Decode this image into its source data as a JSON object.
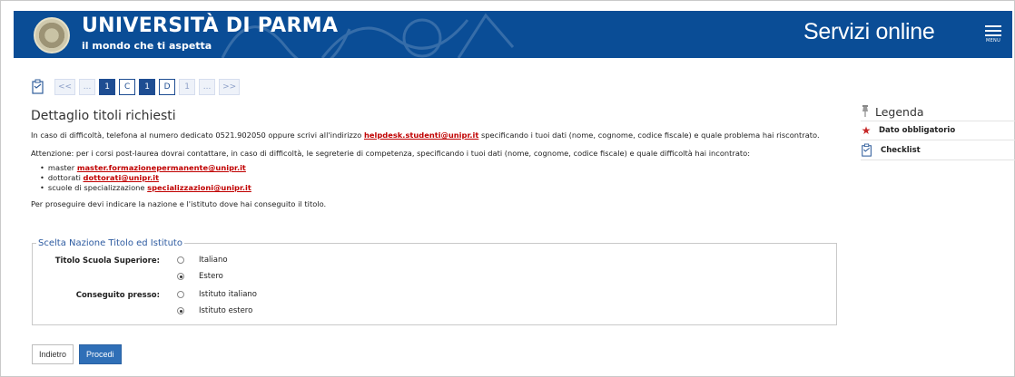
{
  "header": {
    "brand": "UNIVERSITÀ DI PARMA",
    "tagline": "il mondo che ti aspetta",
    "service": "Servizi online",
    "menu_label": "MENU",
    "colors": {
      "bar": "#0a4d96"
    }
  },
  "steps": [
    "<<",
    "...",
    "1",
    "C",
    "1",
    "D",
    "1",
    "...",
    ">>"
  ],
  "main": {
    "title": "Dettaglio titoli richiesti",
    "help_prefix": "In caso di difficoltà, telefona al numero dedicato 0521.902050 oppure scrivi all'indirizzo ",
    "help_email": "helpdesk.studenti@unipr.it",
    "help_suffix": " specificando i tuoi dati (nome, cognome, codice fiscale) e quale problema hai riscontrato.",
    "attention": "Attenzione: per i corsi post-laurea dovrai contattare, in caso di difficoltà, le segreterie di competenza, specificando i tuoi dati (nome, cognome, codice fiscale) e quale difficoltà hai incontrato:",
    "contacts": [
      {
        "label": "master",
        "email": "master.formazionepermanente@unipr.it"
      },
      {
        "label": "dottorati",
        "email": "dottorati@unipr.it"
      },
      {
        "label": "scuole di specializzazione",
        "email": "specializzazioni@unipr.it"
      }
    ],
    "instruction": "Per proseguire devi indicare la nazione e l'istituto dove hai conseguito il titolo."
  },
  "form": {
    "legend": "Scelta Nazione Titolo ed Istituto",
    "titolo_label": "Titolo Scuola Superiore:",
    "titolo_options": [
      "Italiano",
      "Estero"
    ],
    "titolo_selected": "Estero",
    "conseguito_label": "Conseguito presso:",
    "conseguito_options": [
      "Istituto italiano",
      "Istituto estero"
    ],
    "conseguito_selected": "Istituto estero"
  },
  "buttons": {
    "back": "Indietro",
    "next": "Procedi"
  },
  "legend_panel": {
    "title": "Legenda",
    "items": [
      {
        "icon": "asterisk-icon",
        "label": "Dato obbligatorio"
      },
      {
        "icon": "checklist-icon",
        "label": "Checklist"
      }
    ]
  }
}
